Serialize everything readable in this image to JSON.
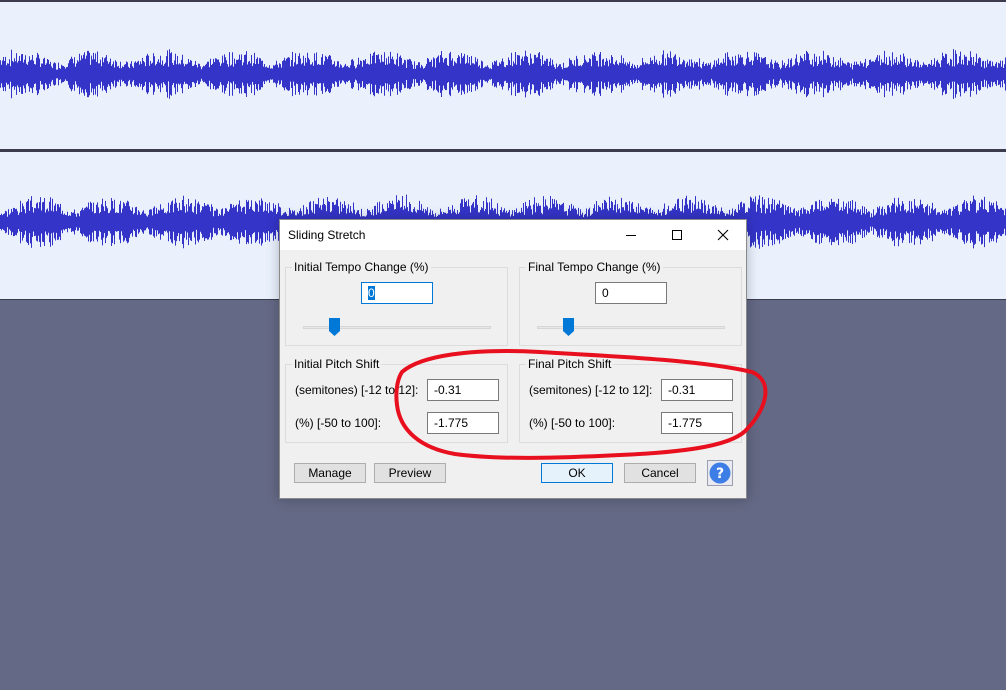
{
  "dialog": {
    "title": "Sliding Stretch",
    "initial_tempo": {
      "label": "Initial Tempo Change (%)",
      "value": "0",
      "slider_position": 0.17
    },
    "final_tempo": {
      "label": "Final Tempo Change (%)",
      "value": "0",
      "slider_position": 0.17
    },
    "initial_pitch": {
      "label": "Initial Pitch Shift",
      "semitones_label": "(semitones) [-12 to 12]:",
      "semitones_value": "-0.31",
      "percent_label": "(%) [-50 to 100]:",
      "percent_value": "-1.775"
    },
    "final_pitch": {
      "label": "Final Pitch Shift",
      "semitones_label": "(semitones) [-12 to 12]:",
      "semitones_value": "-0.31",
      "percent_label": "(%) [-50 to 100]:",
      "percent_value": "-1.775"
    },
    "buttons": {
      "manage": "Manage",
      "preview": "Preview",
      "ok": "OK",
      "cancel": "Cancel"
    },
    "help_icon": "question-icon"
  },
  "colors": {
    "waveform": "#3434c8",
    "track_background": "#eaf1fd",
    "workspace_background": "#646985",
    "annotation": "#e8101e",
    "accent": "#0078d7"
  }
}
